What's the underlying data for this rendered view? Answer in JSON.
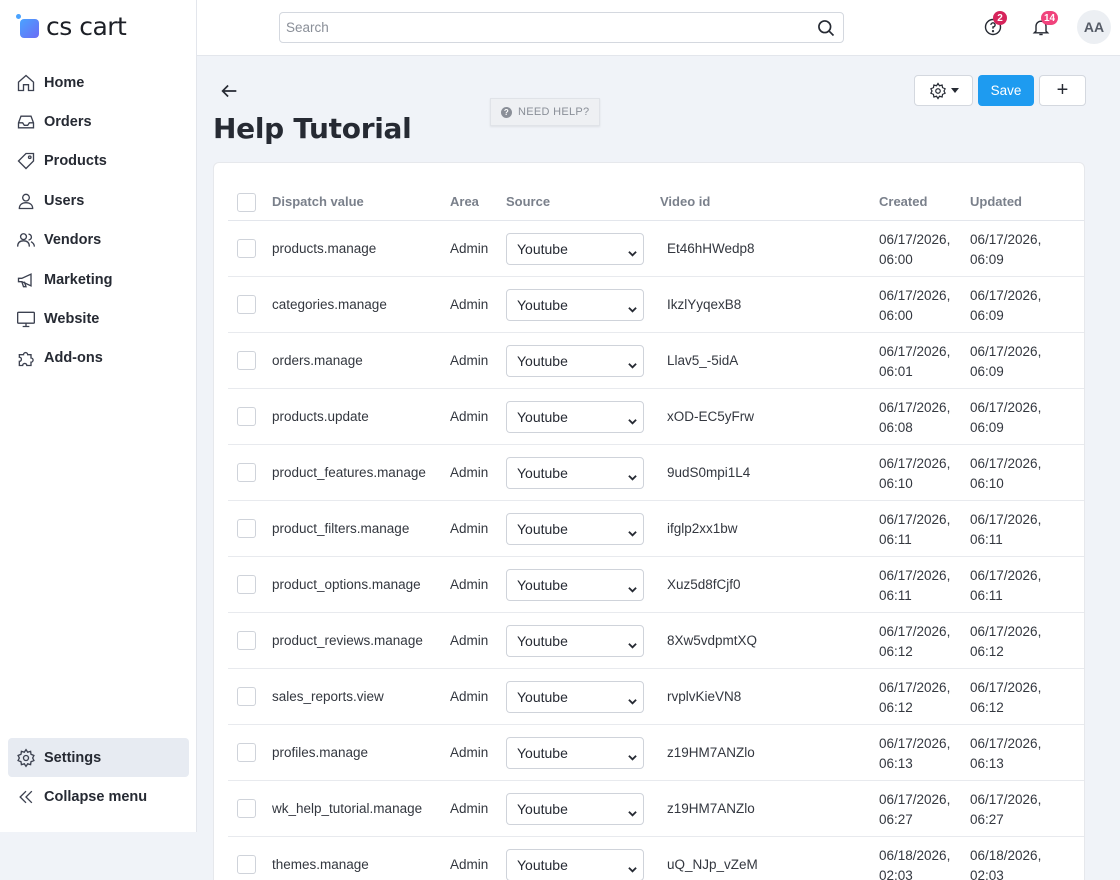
{
  "brand": {
    "name": "cs cart",
    "accent": "#1e9bf0"
  },
  "sidebar": {
    "items": [
      {
        "label": "Home",
        "icon": "home-icon"
      },
      {
        "label": "Orders",
        "icon": "inbox-icon"
      },
      {
        "label": "Products",
        "icon": "tag-icon"
      },
      {
        "label": "Users",
        "icon": "user-icon"
      },
      {
        "label": "Vendors",
        "icon": "users-icon"
      },
      {
        "label": "Marketing",
        "icon": "megaphone-icon"
      },
      {
        "label": "Website",
        "icon": "monitor-icon"
      },
      {
        "label": "Add-ons",
        "icon": "puzzle-icon"
      }
    ],
    "settings_label": "Settings",
    "collapse_label": "Collapse menu"
  },
  "topbar": {
    "search_placeholder": "Search",
    "help_badge": "2",
    "notifications_badge": "14",
    "avatar_initials": "AA"
  },
  "page": {
    "title": "Help Tutorial",
    "need_help": "NEED HELP?",
    "save_label": "Save",
    "add_label": "+"
  },
  "table": {
    "headers": {
      "dispatch": "Dispatch value",
      "area": "Area",
      "source": "Source",
      "video": "Video id",
      "created": "Created",
      "updated": "Updated"
    },
    "rows": [
      {
        "dispatch": "products.manage",
        "area": "Admin",
        "source": "Youtube",
        "video": "Et46hHWedp8",
        "created_date": "06/17/2026,",
        "created_time": "06:00",
        "updated_date": "06/17/2026,",
        "updated_time": "06:09"
      },
      {
        "dispatch": "categories.manage",
        "area": "Admin",
        "source": "Youtube",
        "video": "IkzlYyqexB8",
        "created_date": "06/17/2026,",
        "created_time": "06:00",
        "updated_date": "06/17/2026,",
        "updated_time": "06:09"
      },
      {
        "dispatch": "orders.manage",
        "area": "Admin",
        "source": "Youtube",
        "video": "Llav5_-5idA",
        "created_date": "06/17/2026,",
        "created_time": "06:01",
        "updated_date": "06/17/2026,",
        "updated_time": "06:09"
      },
      {
        "dispatch": "products.update",
        "area": "Admin",
        "source": "Youtube",
        "video": "xOD-EC5yFrw",
        "created_date": "06/17/2026,",
        "created_time": "06:08",
        "updated_date": "06/17/2026,",
        "updated_time": "06:09"
      },
      {
        "dispatch": "product_features.manage",
        "area": "Admin",
        "source": "Youtube",
        "video": "9udS0mpi1L4",
        "created_date": "06/17/2026,",
        "created_time": "06:10",
        "updated_date": "06/17/2026,",
        "updated_time": "06:10"
      },
      {
        "dispatch": "product_filters.manage",
        "area": "Admin",
        "source": "Youtube",
        "video": "ifglp2xx1bw",
        "created_date": "06/17/2026,",
        "created_time": "06:11",
        "updated_date": "06/17/2026,",
        "updated_time": "06:11"
      },
      {
        "dispatch": "product_options.manage",
        "area": "Admin",
        "source": "Youtube",
        "video": "Xuz5d8fCjf0",
        "created_date": "06/17/2026,",
        "created_time": "06:11",
        "updated_date": "06/17/2026,",
        "updated_time": "06:11"
      },
      {
        "dispatch": "product_reviews.manage",
        "area": "Admin",
        "source": "Youtube",
        "video": "8Xw5vdpmtXQ",
        "created_date": "06/17/2026,",
        "created_time": "06:12",
        "updated_date": "06/17/2026,",
        "updated_time": "06:12"
      },
      {
        "dispatch": "sales_reports.view",
        "area": "Admin",
        "source": "Youtube",
        "video": "rvplvKieVN8",
        "created_date": "06/17/2026,",
        "created_time": "06:12",
        "updated_date": "06/17/2026,",
        "updated_time": "06:12"
      },
      {
        "dispatch": "profiles.manage",
        "area": "Admin",
        "source": "Youtube",
        "video": "z19HM7ANZlo",
        "created_date": "06/17/2026,",
        "created_time": "06:13",
        "updated_date": "06/17/2026,",
        "updated_time": "06:13"
      },
      {
        "dispatch": "wk_help_tutorial.manage",
        "area": "Admin",
        "source": "Youtube",
        "video": "z19HM7ANZlo",
        "created_date": "06/17/2026,",
        "created_time": "06:27",
        "updated_date": "06/17/2026,",
        "updated_time": "06:27"
      },
      {
        "dispatch": "themes.manage",
        "area": "Admin",
        "source": "Youtube",
        "video": "uQ_NJp_vZeM",
        "created_date": "06/18/2026,",
        "created_time": "02:03",
        "updated_date": "06/18/2026,",
        "updated_time": "02:03"
      }
    ]
  }
}
